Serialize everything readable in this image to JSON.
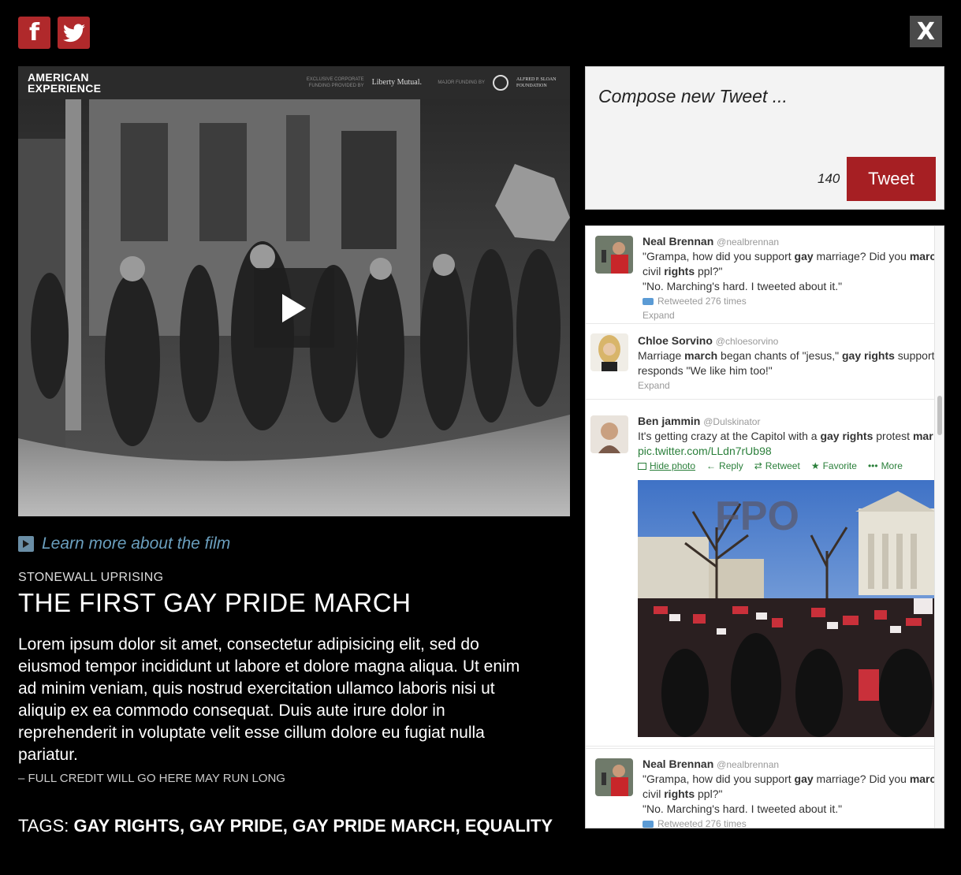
{
  "social": {
    "facebook_glyph": "f"
  },
  "close": {
    "label": "X"
  },
  "video": {
    "brand_line1": "AMERICAN",
    "brand_line2": "EXPERIENCE",
    "sponsor1_note": "EXCLUSIVE CORPORATE FUNDING PROVIDED BY",
    "sponsor1_name": "Liberty Mutual.",
    "sponsor2_note": "MAJOR FUNDING BY",
    "sponsor2_name": "ALFRED P. SLOAN FOUNDATION"
  },
  "article": {
    "learn_more": "Learn more about the film",
    "kicker": "STONEWALL UPRISING",
    "title": "THE FIRST GAY PRIDE MARCH",
    "body": "Lorem ipsum dolor sit amet, consectetur adipisicing elit, sed do eiusmod tempor incididunt ut labore et dolore magna aliqua. Ut enim ad minim veniam, quis nostrud exercitation ullamco laboris nisi ut aliquip ex ea commodo consequat. Duis aute irure dolor in reprehenderit in voluptate velit esse cillum dolore eu fugiat nulla pariatur.",
    "credit": "– FULL CREDIT WILL GO HERE MAY RUN LONG",
    "tags_label": "TAGS: ",
    "tags": "GAY RIGHTS, GAY PRIDE, GAY PRIDE MARCH, EQUALITY"
  },
  "compose": {
    "placeholder": "Compose new Tweet ...",
    "count": "140",
    "button": "Tweet"
  },
  "tweets": [
    {
      "name": "Neal Brennan",
      "handle": "@nealbrennan",
      "line1_a": "\"Grampa, how did you support ",
      "line1_b": "gay",
      "line1_c": " marriage? Did you ",
      "line1_d": "marc",
      "line2_a": "civil ",
      "line2_b": "rights",
      "line2_c": " ppl?\"",
      "line3": "\"No. Marching's hard. I tweeted about it.\"",
      "retweeted": "Retweeted 276 times",
      "expand": "Expand"
    },
    {
      "name": "Chloe Sorvino",
      "handle": "@chloesorvino",
      "line1_a": "Marriage ",
      "line1_b": "march",
      "line1_c": " began chants of \"jesus,\" ",
      "line1_d": "gay rights",
      "line1_e": " support",
      "line2": "responds \"We like him too!\"",
      "expand": "Expand"
    },
    {
      "name": "Ben jammin",
      "handle": "@Dulskinator",
      "line1_a": "It's getting crazy at the Capitol with a ",
      "line1_b": "gay rights",
      "line1_c": " protest ",
      "line1_d": "mar",
      "link": "pic.twitter.com/LLdn7rUb98",
      "hide_photo": "Hide photo",
      "reply": "Reply",
      "retweet": "Retweet",
      "favorite": "Favorite",
      "more": "More",
      "photo_overlay": "FPO"
    },
    {
      "name": "Neal Brennan",
      "handle": "@nealbrennan",
      "line1_a": "\"Grampa, how did you support ",
      "line1_b": "gay",
      "line1_c": " marriage? Did you ",
      "line1_d": "marc",
      "line2_a": "civil ",
      "line2_b": "rights",
      "line2_c": " ppl?\"",
      "line3": "\"No. Marching's hard. I tweeted about it.\"",
      "retweeted": "Retweeted 276 times"
    }
  ],
  "colors": {
    "accent_red": "#a61f23",
    "link_blue": "#6a9fbe",
    "tweet_link_green": "#2a7f3a"
  }
}
